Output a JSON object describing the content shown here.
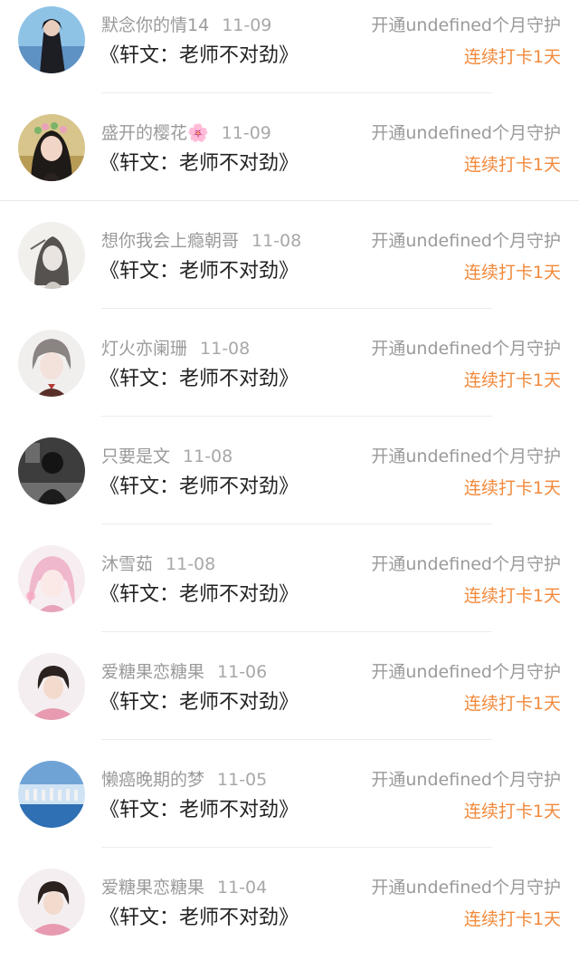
{
  "records": [
    {
      "user": "默念你的情14",
      "date": "11-09",
      "book": "《轩文：老师不对劲》",
      "action": "开通undefined个月守护",
      "streak": "连续打卡1天",
      "avatar": "avatar-girl-dark-hair-blue-bg"
    },
    {
      "user": "盛开的樱花🌸",
      "date": "11-09",
      "book": "《轩文：老师不对劲》",
      "action": "开通undefined个月守护",
      "streak": "连续打卡1天",
      "avatar": "avatar-girl-flower-crown"
    },
    {
      "user": "想你我会上瘾朝哥",
      "date": "11-08",
      "book": "《轩文：老师不对劲》",
      "action": "开通undefined个月守护",
      "streak": "连续打卡1天",
      "avatar": "avatar-sketch-portrait"
    },
    {
      "user": "灯火亦阑珊",
      "date": "11-08",
      "book": "《轩文：老师不对劲》",
      "action": "开通undefined个月守护",
      "streak": "连续打卡1天",
      "avatar": "avatar-anime-boy-grey-hair"
    },
    {
      "user": "只要是文",
      "date": "11-08",
      "book": "《轩文：老师不对劲》",
      "action": "开通undefined个月守护",
      "streak": "连续打卡1天",
      "avatar": "avatar-dark-photo"
    },
    {
      "user": "沐雪茹",
      "date": "11-08",
      "book": "《轩文：老师不对劲》",
      "action": "开通undefined个月守护",
      "streak": "连续打卡1天",
      "avatar": "avatar-anime-girl-pink-hair"
    },
    {
      "user": "爱糖果恋糖果",
      "date": "11-06",
      "book": "《轩文：老师不对劲》",
      "action": "开通undefined个月守护",
      "streak": "连续打卡1天",
      "avatar": "avatar-boy-pink-shirt"
    },
    {
      "user": "懒癌晚期的梦",
      "date": "11-05",
      "book": "《轩文：老师不对劲》",
      "action": "开通undefined个月守护",
      "streak": "连续打卡1天",
      "avatar": "avatar-group-on-stage"
    },
    {
      "user": "爱糖果恋糖果",
      "date": "11-04",
      "book": "《轩文：老师不对劲》",
      "action": "开通undefined个月守护",
      "streak": "连续打卡1天",
      "avatar": "avatar-boy-pink-shirt"
    }
  ]
}
